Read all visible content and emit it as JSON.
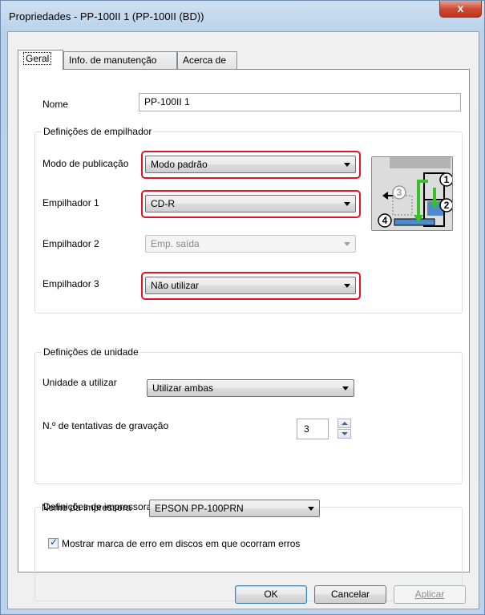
{
  "window": {
    "title": "Propriedades - PP-100II 1 (PP-100II (BD))",
    "close_glyph": "x"
  },
  "tabs": [
    {
      "label": "Geral"
    },
    {
      "label": "Info. de manutenção"
    },
    {
      "label": "Acerca de"
    }
  ],
  "general": {
    "name_label": "Nome",
    "name_value": "PP-100II 1"
  },
  "stacker_settings": {
    "title": "Definições de empilhador",
    "publish_mode_label": "Modo de publicação",
    "publish_mode_value": "Modo padrão",
    "stacker1_label": "Empilhador 1",
    "stacker1_value": "CD-R",
    "stacker2_label": "Empilhador 2",
    "stacker2_value": "Emp. saída",
    "stacker3_label": "Empilhador 3",
    "stacker3_value": "Não utilizar",
    "diagram_labels": [
      "1",
      "2",
      "3",
      "4"
    ]
  },
  "drive_settings": {
    "title": "Definições de unidade",
    "drive_label": "Unidade a utilizar",
    "drive_value": "Utilizar ambas",
    "retries_label": "N.º de tentativas de gravação",
    "retries_value": "3"
  },
  "printer_settings": {
    "title": "Definições de impressora",
    "printer_label": "Nome da impressora",
    "printer_value": "EPSON PP-100PRN",
    "error_mark_label": "Mostrar marca de erro em discos em que ocorram erros",
    "error_mark_checked": true
  },
  "buttons": {
    "ok": "OK",
    "cancel": "Cancelar",
    "apply": "Aplicar"
  },
  "colors": {
    "highlight": "#e0152a",
    "arrow_green": "#3bbf2a",
    "window_bg": "#f0f0f0"
  }
}
